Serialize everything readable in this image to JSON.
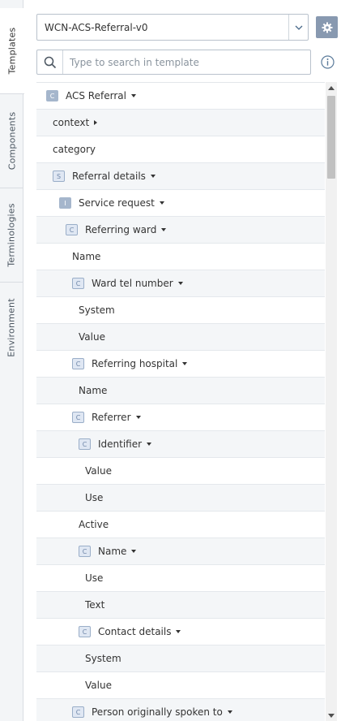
{
  "sidebar": {
    "tabs": [
      {
        "label": "Templates",
        "active": true
      },
      {
        "label": "Components",
        "active": false
      },
      {
        "label": "Terminologies",
        "active": false
      },
      {
        "label": "Environment",
        "active": false
      }
    ]
  },
  "toolbar": {
    "template_select": {
      "value": "WCN-ACS-Referral-v0",
      "icon": "chevron-down-icon"
    },
    "settings_icon": "gear-icon",
    "search": {
      "placeholder": "Type to search in template",
      "value": "",
      "icon": "search-icon"
    },
    "info_icon": "info-icon"
  },
  "colors": {
    "accent": "#8899b0",
    "row_alt": "#f4f6f8",
    "border": "#b9c2cc"
  },
  "tree": {
    "rows": [
      {
        "label": "ACS Referral",
        "icon": "C",
        "icon_style": "solid",
        "caret": "down",
        "depth": 0
      },
      {
        "label": "context",
        "icon": "",
        "caret": "right",
        "depth": 0
      },
      {
        "label": "category",
        "icon": "",
        "caret": "",
        "depth": 0
      },
      {
        "label": "Referral details",
        "icon": "S",
        "caret": "down",
        "depth": 1
      },
      {
        "label": "Service request",
        "icon": "I",
        "icon_style": "solid",
        "caret": "down",
        "depth": 2
      },
      {
        "label": "Referring ward",
        "icon": "C",
        "caret": "down",
        "depth": 3
      },
      {
        "label": "Name",
        "icon": "",
        "caret": "",
        "depth": 3
      },
      {
        "label": "Ward tel number",
        "icon": "C",
        "caret": "down",
        "depth": 4
      },
      {
        "label": "System",
        "icon": "",
        "caret": "",
        "depth": 4
      },
      {
        "label": "Value",
        "icon": "",
        "caret": "",
        "depth": 4
      },
      {
        "label": "Referring hospital",
        "icon": "C",
        "caret": "down",
        "depth": 4
      },
      {
        "label": "Name",
        "icon": "",
        "caret": "",
        "depth": 4
      },
      {
        "label": "Referrer",
        "icon": "C",
        "caret": "down",
        "depth": 4
      },
      {
        "label": "Identifier",
        "icon": "C",
        "caret": "down",
        "depth": 5
      },
      {
        "label": "Value",
        "icon": "",
        "caret": "",
        "depth": 5
      },
      {
        "label": "Use",
        "icon": "",
        "caret": "",
        "depth": 5
      },
      {
        "label": "Active",
        "icon": "",
        "caret": "",
        "depth": 4
      },
      {
        "label": "Name",
        "icon": "C",
        "caret": "down",
        "depth": 5
      },
      {
        "label": "Use",
        "icon": "",
        "caret": "",
        "depth": 5
      },
      {
        "label": "Text",
        "icon": "",
        "caret": "",
        "depth": 5
      },
      {
        "label": "Contact details",
        "icon": "C",
        "caret": "down",
        "depth": 5
      },
      {
        "label": "System",
        "icon": "",
        "caret": "",
        "depth": 5
      },
      {
        "label": "Value",
        "icon": "",
        "caret": "",
        "depth": 5
      },
      {
        "label": "Person originally spoken to",
        "icon": "C",
        "caret": "down",
        "depth": 4
      }
    ]
  },
  "scrollbar": {
    "position": 0.0
  }
}
